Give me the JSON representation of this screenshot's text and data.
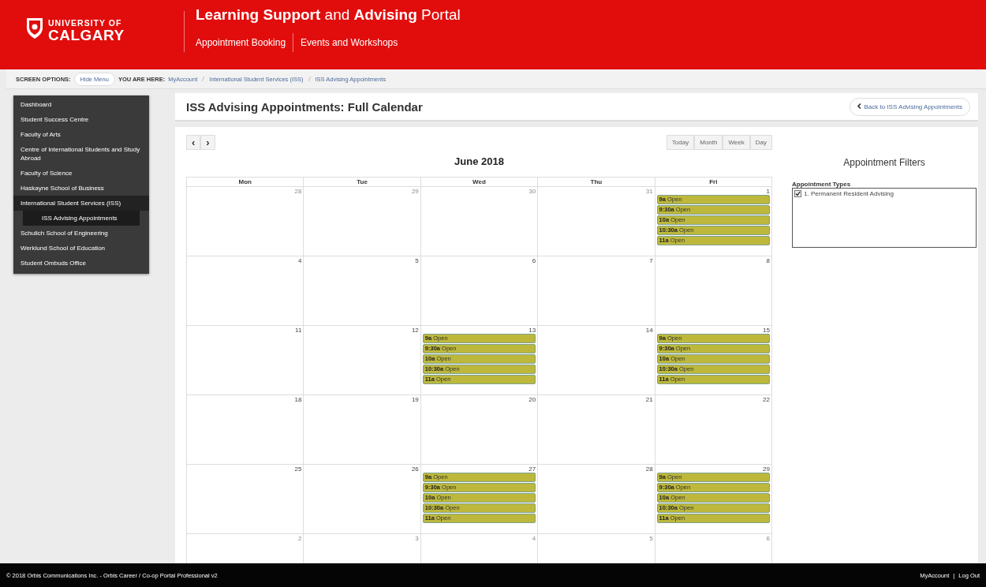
{
  "header": {
    "logo_line1": "UNIVERSITY OF",
    "logo_line2": "CALGARY",
    "title": "**Learning Support** and **Advising** Portal",
    "nav": [
      "Appointment Booking",
      "Events and Workshops"
    ]
  },
  "screen_options": {
    "label": "SCREEN OPTIONS:",
    "button": "Hide Menu",
    "you_are_here": "YOU ARE HERE:",
    "breadcrumbs": [
      "MyAccount",
      "International Student Services (ISS)",
      "ISS Advising Appointments"
    ]
  },
  "sidebar": {
    "items": [
      {
        "label": "Dashboard",
        "selected": false
      },
      {
        "label": "Student Success Centre",
        "selected": false
      },
      {
        "label": "Faculty of Arts",
        "selected": false
      },
      {
        "label": "Centre of International Students and Study Abroad",
        "selected": false
      },
      {
        "label": "Faculty of Science",
        "selected": false
      },
      {
        "label": "Haskayne School of Business",
        "selected": false
      },
      {
        "label": "International Student Services (ISS)",
        "selected": true,
        "children": [
          {
            "label": "ISS Advising Appointments",
            "selected": true
          }
        ]
      },
      {
        "label": "Schulich School of Engineering",
        "selected": false
      },
      {
        "label": "Werklund School of Education",
        "selected": false
      },
      {
        "label": "Student Ombuds Office",
        "selected": false
      }
    ]
  },
  "page": {
    "title": "ISS Advising Appointments: Full Calendar",
    "back_button": "Back to ISS Advising Appointments"
  },
  "calendar": {
    "prev": "‹",
    "next": "›",
    "views": [
      "Today",
      "Month",
      "Week",
      "Day"
    ],
    "month": "June 2018",
    "weekdays": [
      "Mon",
      "Tue",
      "Wed",
      "Thu",
      "Fri"
    ],
    "weeks": [
      {
        "days": [
          {
            "number": "28",
            "other_month": true
          },
          {
            "number": "29",
            "other_month": true
          },
          {
            "number": "30",
            "other_month": true
          },
          {
            "number": "31",
            "other_month": true
          },
          {
            "number": "1",
            "other_month": false,
            "events": [
              "**9a** Open",
              "**9:30a** Open",
              "**10a** Open",
              "**10:30a** Open",
              "**11a** Open"
            ]
          }
        ]
      },
      {
        "days": [
          {
            "number": "4",
            "other_month": false
          },
          {
            "number": "5",
            "other_month": false
          },
          {
            "number": "6",
            "other_month": false
          },
          {
            "number": "7",
            "other_month": false
          },
          {
            "number": "8",
            "other_month": false
          }
        ]
      },
      {
        "days": [
          {
            "number": "11",
            "other_month": false
          },
          {
            "number": "12",
            "other_month": false
          },
          {
            "number": "13",
            "other_month": false,
            "events": [
              "**9a** Open",
              "**9:30a** Open",
              "**10a** Open",
              "**10:30a** Open",
              "**11a** Open"
            ]
          },
          {
            "number": "14",
            "other_month": false
          },
          {
            "number": "15",
            "other_month": false,
            "events": [
              "**9a** Open",
              "**9:30a** Open",
              "**10a** Open",
              "**10:30a** Open",
              "**11a** Open"
            ]
          }
        ]
      },
      {
        "days": [
          {
            "number": "18",
            "other_month": false
          },
          {
            "number": "19",
            "other_month": false
          },
          {
            "number": "20",
            "other_month": false
          },
          {
            "number": "21",
            "other_month": false
          },
          {
            "number": "22",
            "other_month": false
          }
        ]
      },
      {
        "days": [
          {
            "number": "25",
            "other_month": false
          },
          {
            "number": "26",
            "other_month": false
          },
          {
            "number": "27",
            "other_month": false,
            "events": [
              "**9a** Open",
              "**9:30a** Open",
              "**10a** Open",
              "**10:30a** Open",
              "**11a** Open"
            ]
          },
          {
            "number": "28",
            "other_month": false
          },
          {
            "number": "29",
            "other_month": false,
            "events": [
              "**9a** Open",
              "**9:30a** Open",
              "**10a** Open",
              "**10:30a** Open",
              "**11a** Open"
            ]
          }
        ]
      },
      {
        "days": [
          {
            "number": "2",
            "other_month": true
          },
          {
            "number": "3",
            "other_month": true
          },
          {
            "number": "4",
            "other_month": true
          },
          {
            "number": "5",
            "other_month": true
          },
          {
            "number": "6",
            "other_month": true
          }
        ]
      }
    ]
  },
  "filters": {
    "title": "Appointment Filters",
    "types_label": "Appointment Types",
    "types": [
      {
        "label": "1. Permanent Resident Advising",
        "checked": true
      }
    ]
  },
  "footer": {
    "copyright": "© 2018 Orbis Communications Inc. - Orbis Career / Co-op Portal Professional v2",
    "links": [
      "MyAccount",
      "Log Out"
    ],
    "separator": "|"
  }
}
